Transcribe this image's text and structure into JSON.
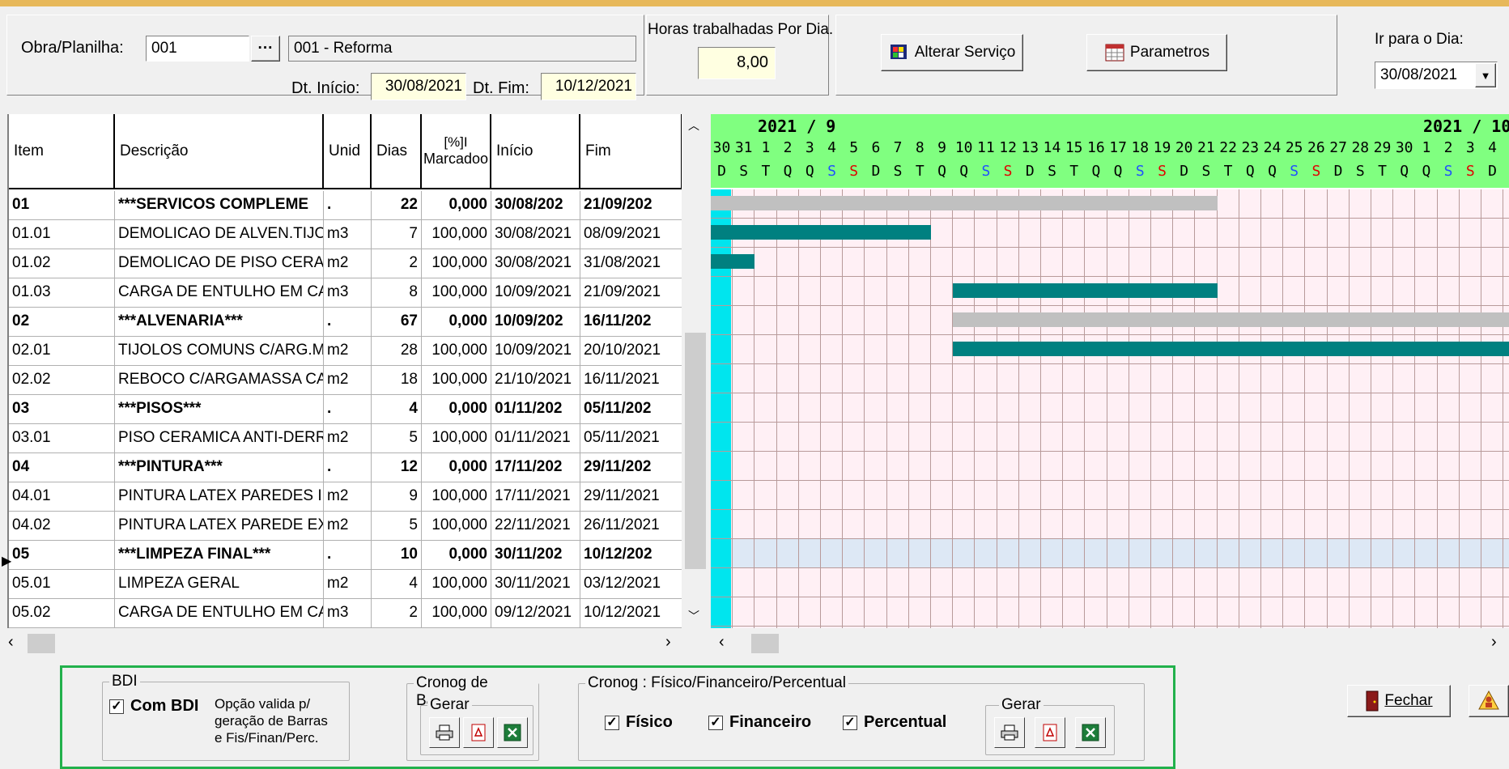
{
  "header": {
    "obra_label": "Obra/Planilha:",
    "obra_code": "001",
    "lookup_button": "···",
    "obra_desc": "001 - Reforma",
    "dt_inicio_label": "Dt. Início:",
    "dt_inicio": "30/08/2021",
    "dt_fim_label": "Dt. Fim:",
    "dt_fim": "10/12/2021",
    "horas_label": "Horas trabalhadas Por Dia.",
    "horas_value": "8,00",
    "alterar_servico": "Alterar Serviço",
    "parametros": "Parametros",
    "ir_para_label": "Ir para o Dia:",
    "ir_para_value": "30/08/2021"
  },
  "columns": {
    "item": "Item",
    "descricao": "Descrição",
    "unid": "Unid",
    "dias": "Dias",
    "pct_top": "[%]I",
    "pct_bottom": "Marcadoo",
    "inicio": "Início",
    "fim": "Fim"
  },
  "rows": [
    {
      "item": "01",
      "desc": "***SERVICOS COMPLEME",
      "unid": ".",
      "dias": "22",
      "pct": "0,000",
      "inicio": "30/08/202",
      "fim": "21/09/202"
    },
    {
      "item": "01.01",
      "desc": "DEMOLICAO DE ALVEN.TIJOL",
      "unid": "m3",
      "dias": "7",
      "pct": "100,000",
      "inicio": "30/08/2021",
      "fim": "08/09/2021"
    },
    {
      "item": "01.02",
      "desc": "DEMOLICAO DE PISO CERAM",
      "unid": "m2",
      "dias": "2",
      "pct": "100,000",
      "inicio": "30/08/2021",
      "fim": "31/08/2021"
    },
    {
      "item": "01.03",
      "desc": "CARGA DE ENTULHO EM CAM",
      "unid": "m3",
      "dias": "8",
      "pct": "100,000",
      "inicio": "10/09/2021",
      "fim": "21/09/2021"
    },
    {
      "item": "02",
      "desc": "***ALVENARIA***",
      "unid": ".",
      "dias": "67",
      "pct": "0,000",
      "inicio": "10/09/202",
      "fim": "16/11/202"
    },
    {
      "item": "02.01",
      "desc": "TIJOLOS COMUNS C/ARG.MIS",
      "unid": "m2",
      "dias": "28",
      "pct": "100,000",
      "inicio": "10/09/2021",
      "fim": "20/10/2021"
    },
    {
      "item": "02.02",
      "desc": "REBOCO C/ARGAMASSA CAL",
      "unid": "m2",
      "dias": "18",
      "pct": "100,000",
      "inicio": "21/10/2021",
      "fim": "16/11/2021"
    },
    {
      "item": "03",
      "desc": "***PISOS***",
      "unid": ".",
      "dias": "4",
      "pct": "0,000",
      "inicio": "01/11/202",
      "fim": "05/11/202"
    },
    {
      "item": "03.01",
      "desc": "PISO CERAMICA ANTI-DERRA",
      "unid": "m2",
      "dias": "5",
      "pct": "100,000",
      "inicio": "01/11/2021",
      "fim": "05/11/2021"
    },
    {
      "item": "04",
      "desc": "***PINTURA***",
      "unid": ".",
      "dias": "12",
      "pct": "0,000",
      "inicio": "17/11/202",
      "fim": "29/11/202"
    },
    {
      "item": "04.01",
      "desc": "PINTURA LATEX PAREDES IN",
      "unid": "m2",
      "dias": "9",
      "pct": "100,000",
      "inicio": "17/11/2021",
      "fim": "29/11/2021"
    },
    {
      "item": "04.02",
      "desc": "PINTURA LATEX PAREDE EX",
      "unid": "m2",
      "dias": "5",
      "pct": "100,000",
      "inicio": "22/11/2021",
      "fim": "26/11/2021"
    },
    {
      "item": "05",
      "desc": "***LIMPEZA FINAL***",
      "unid": ".",
      "dias": "10",
      "pct": "0,000",
      "inicio": "30/11/202",
      "fim": "10/12/202"
    },
    {
      "item": "05.01",
      "desc": "LIMPEZA GERAL",
      "unid": "m2",
      "dias": "4",
      "pct": "100,000",
      "inicio": "30/11/2021",
      "fim": "03/12/2021"
    },
    {
      "item": "05.02",
      "desc": "CARGA DE ENTULHO EM CAM",
      "unid": "m3",
      "dias": "2",
      "pct": "100,000",
      "inicio": "09/12/2021",
      "fim": "10/12/2021"
    }
  ],
  "gantt": {
    "month1_label": "2021 / 9",
    "month2_label": "2021 / 10",
    "days": [
      "30",
      "31",
      "1",
      "2",
      "3",
      "4",
      "5",
      "6",
      "7",
      "8",
      "9",
      "10",
      "11",
      "12",
      "13",
      "14",
      "15",
      "16",
      "17",
      "18",
      "19",
      "20",
      "21",
      "22",
      "23",
      "24",
      "25",
      "26",
      "27",
      "28",
      "29",
      "30",
      "1",
      "2",
      "3",
      "4"
    ],
    "weekdays": [
      "D",
      "S",
      "T",
      "Q",
      "Q",
      "S",
      "S",
      "D",
      "S",
      "T",
      "Q",
      "Q",
      "S",
      "S",
      "D",
      "S",
      "T",
      "Q",
      "Q",
      "S",
      "S",
      "D",
      "S",
      "T",
      "Q",
      "Q",
      "S",
      "S",
      "D",
      "S",
      "T",
      "Q",
      "Q",
      "S",
      "S",
      "D"
    ],
    "colors": {
      "summary": "#c0c0c0",
      "task": "#008080",
      "today": "#00e5ee",
      "grid_bg": "#fff0f5",
      "selected_row": "#dde8f5",
      "header": "#80ff80"
    }
  },
  "bottom": {
    "bdi_title": "BDI",
    "com_bdi": "Com BDI",
    "bdi_note_1": "Opção valida p/",
    "bdi_note_2": "geração de Barras",
    "bdi_note_3": "e Fis/Finan/Perc.",
    "cronog_barras_title": "Cronog de Barras",
    "gerar": "Gerar",
    "cronog_ffp_title": "Cronog : Físico/Financeiro/Percentual",
    "fisico": "Físico",
    "financeiro": "Financeiro",
    "percentual": "Percentual",
    "fechar": "Fechar",
    "check_mark": "✓"
  }
}
